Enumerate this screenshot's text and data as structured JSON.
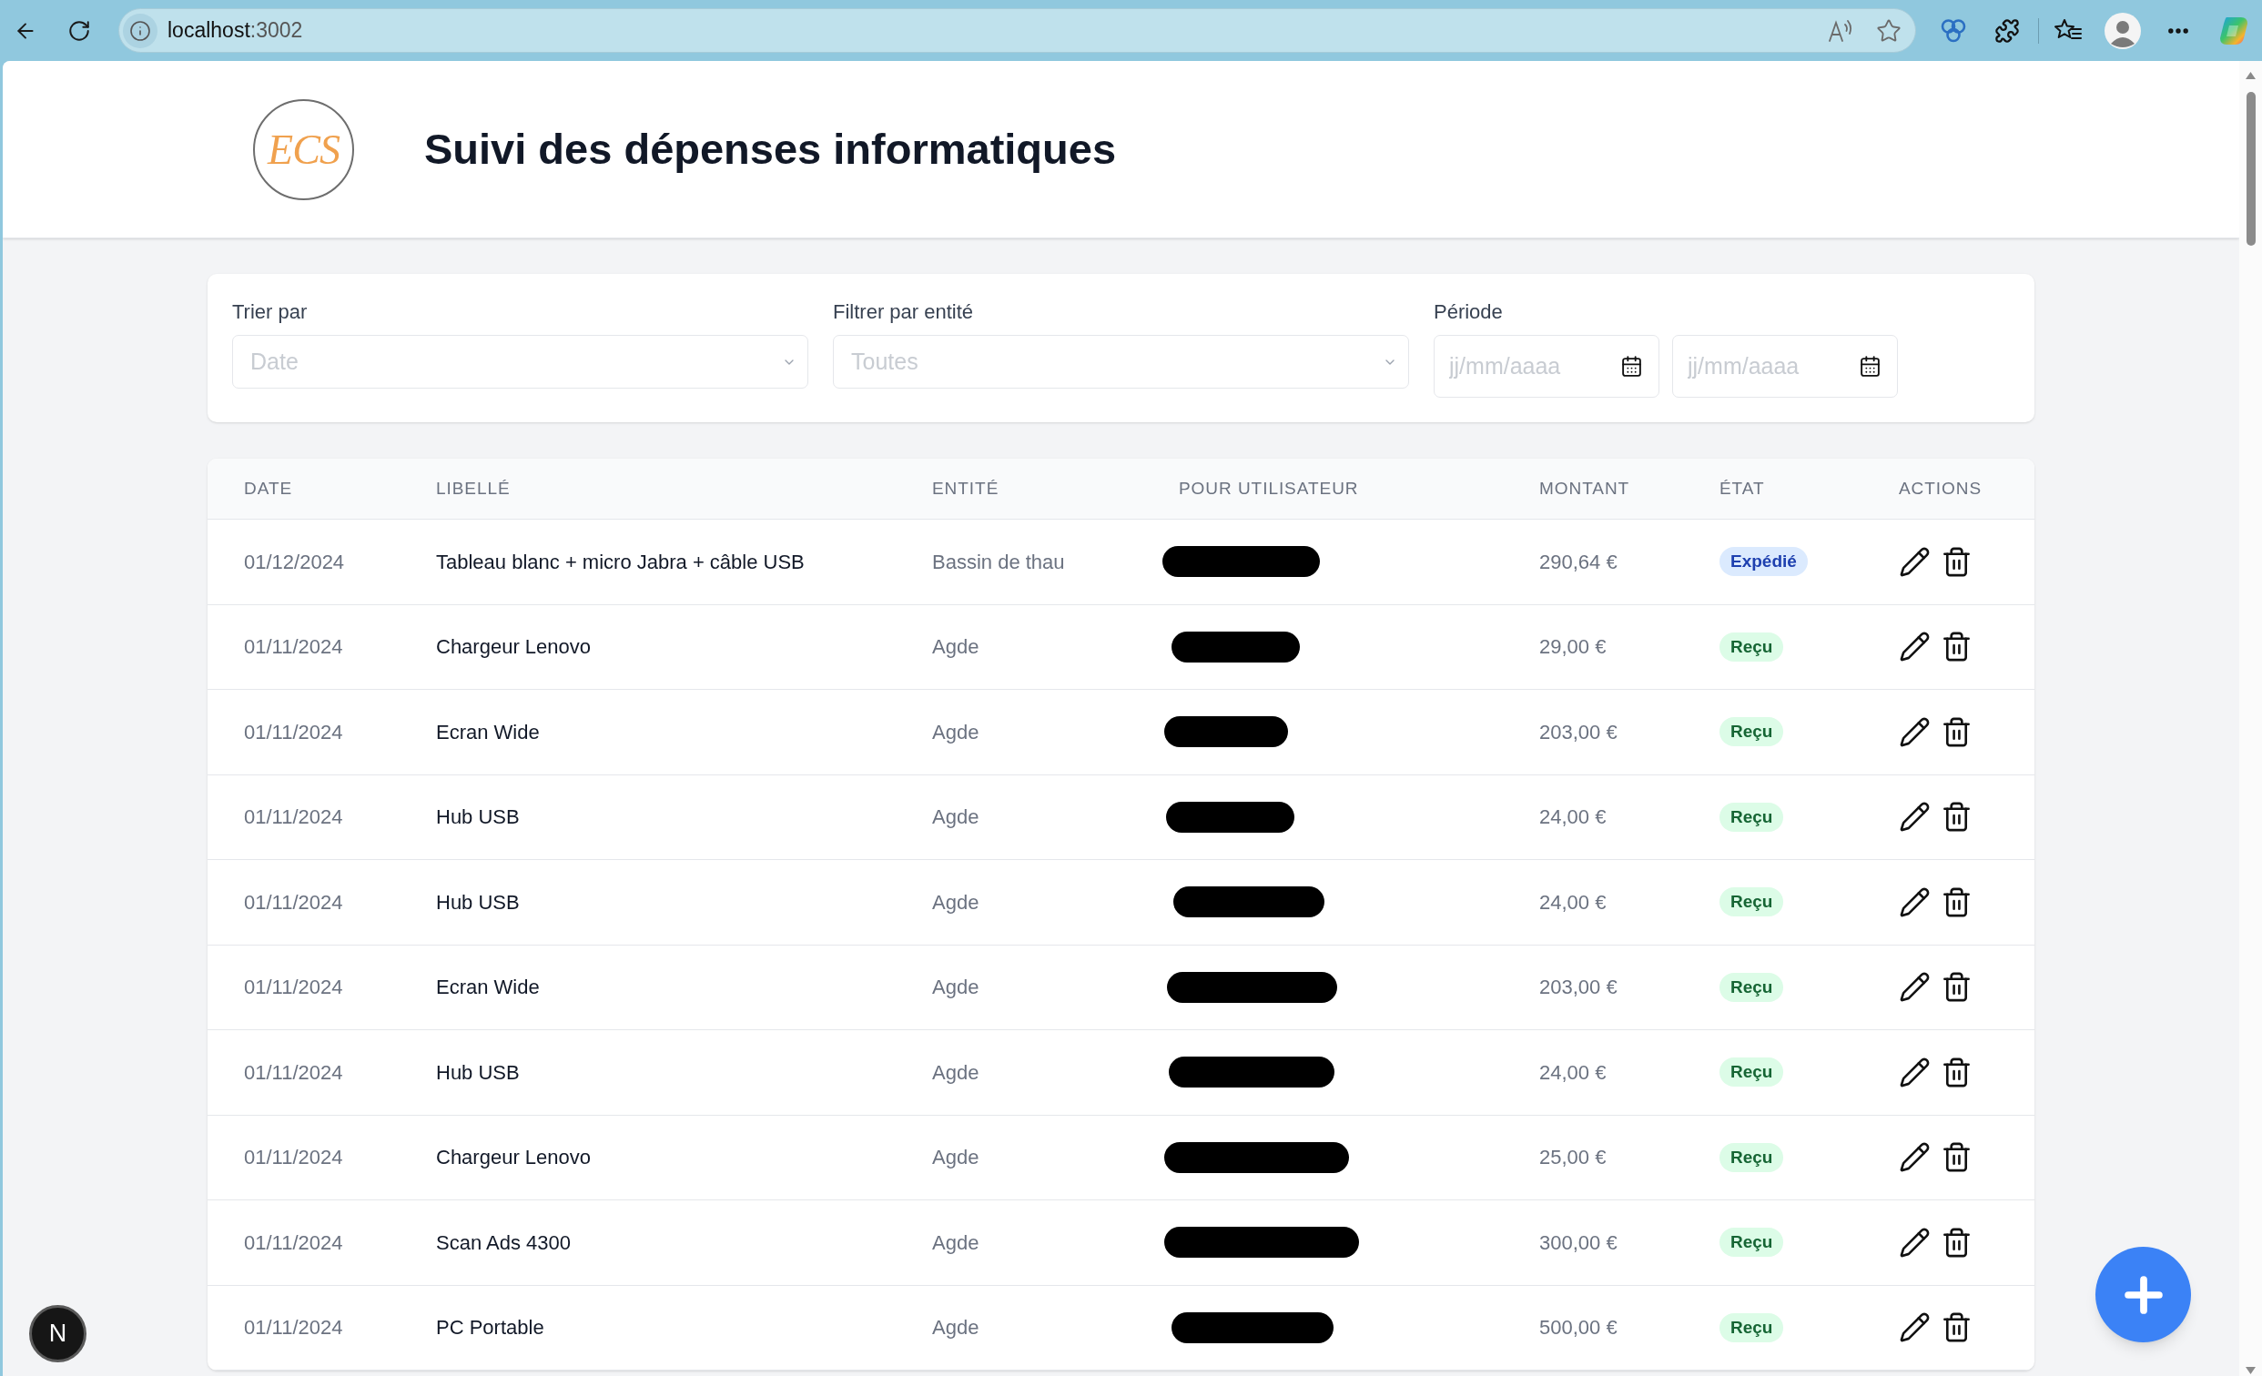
{
  "browser": {
    "address": {
      "host": "localhost",
      "port": ":3002"
    }
  },
  "header": {
    "logo_text": "ECS",
    "title": "Suivi des dépenses informatiques"
  },
  "filters": {
    "sort": {
      "label": "Trier par",
      "value": "Date"
    },
    "entity": {
      "label": "Filtrer par entité",
      "value": "Toutes"
    },
    "period": {
      "label": "Période",
      "start": {
        "placeholder": "jj/mm/aaaa"
      },
      "end": {
        "placeholder": "jj/mm/aaaa"
      }
    }
  },
  "table": {
    "columns": [
      "DATE",
      "LIBELLÉ",
      "ENTITÉ",
      "POUR UTILISATEUR",
      "MONTANT",
      "ÉTAT",
      "ACTIONS"
    ],
    "rows": [
      {
        "date": "01/12/2024",
        "label": "Tableau blanc + micro Jabra + câble USB",
        "entity": "Bassin de thau",
        "user": {
          "redacted": true
        },
        "amount": "290,64 €",
        "state": {
          "label": "Expédié",
          "kind": "shipped"
        }
      },
      {
        "date": "01/11/2024",
        "label": "Chargeur Lenovo",
        "entity": "Agde",
        "user": {
          "redacted": true
        },
        "amount": "29,00 €",
        "state": {
          "label": "Reçu",
          "kind": "received"
        }
      },
      {
        "date": "01/11/2024",
        "label": "Ecran Wide",
        "entity": "Agde",
        "user": {
          "redacted": true
        },
        "amount": "203,00 €",
        "state": {
          "label": "Reçu",
          "kind": "received"
        }
      },
      {
        "date": "01/11/2024",
        "label": "Hub USB",
        "entity": "Agde",
        "user": {
          "redacted": true
        },
        "amount": "24,00 €",
        "state": {
          "label": "Reçu",
          "kind": "received"
        }
      },
      {
        "date": "01/11/2024",
        "label": "Hub USB",
        "entity": "Agde",
        "user": {
          "redacted": true
        },
        "amount": "24,00 €",
        "state": {
          "label": "Reçu",
          "kind": "received"
        }
      },
      {
        "date": "01/11/2024",
        "label": "Ecran Wide",
        "entity": "Agde",
        "user": {
          "redacted": true
        },
        "amount": "203,00 €",
        "state": {
          "label": "Reçu",
          "kind": "received"
        }
      },
      {
        "date": "01/11/2024",
        "label": "Hub USB",
        "entity": "Agde",
        "user": {
          "redacted": true
        },
        "amount": "24,00 €",
        "state": {
          "label": "Reçu",
          "kind": "received"
        }
      },
      {
        "date": "01/11/2024",
        "label": "Chargeur Lenovo",
        "entity": "Agde",
        "user": {
          "redacted": true
        },
        "amount": "25,00 €",
        "state": {
          "label": "Reçu",
          "kind": "received"
        }
      },
      {
        "date": "01/11/2024",
        "label": "Scan Ads 4300",
        "entity": "Agde",
        "user": {
          "redacted": true
        },
        "amount": "300,00 €",
        "state": {
          "label": "Reçu",
          "kind": "received"
        }
      },
      {
        "date": "01/11/2024",
        "label": "PC Portable",
        "entity": "Agde",
        "user": {
          "redacted": true
        },
        "amount": "500,00 €",
        "state": {
          "label": "Reçu",
          "kind": "received"
        }
      }
    ]
  },
  "dev_badge": {
    "label": "N"
  }
}
